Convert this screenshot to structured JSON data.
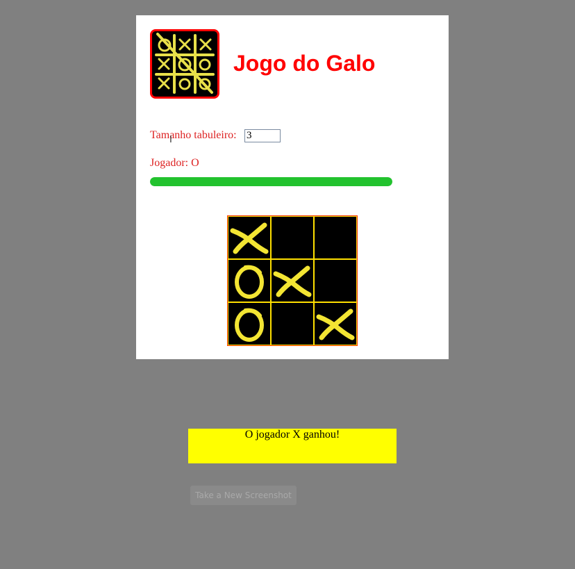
{
  "header": {
    "title": "Jogo do Galo",
    "logo_icon": "tic-tac-toe-logo-icon"
  },
  "settings": {
    "board_size_label": "Tamanho tabuleiro:",
    "board_size_value": "3"
  },
  "status": {
    "player_label": "Jogador: O",
    "timer_progress_percent": 100
  },
  "board": {
    "size": 3,
    "cells": [
      "X",
      "",
      "",
      "O",
      "X",
      "",
      "O",
      "",
      "X"
    ]
  },
  "result": {
    "message": "O jogador X ganhou!"
  },
  "actions": {
    "new_screenshot_label": "Take a New Screenshot"
  },
  "colors": {
    "accent_red": "#ff0000",
    "mark_yellow": "#f3e533",
    "progress_green": "#22c22e",
    "message_bg": "#ffff00"
  }
}
